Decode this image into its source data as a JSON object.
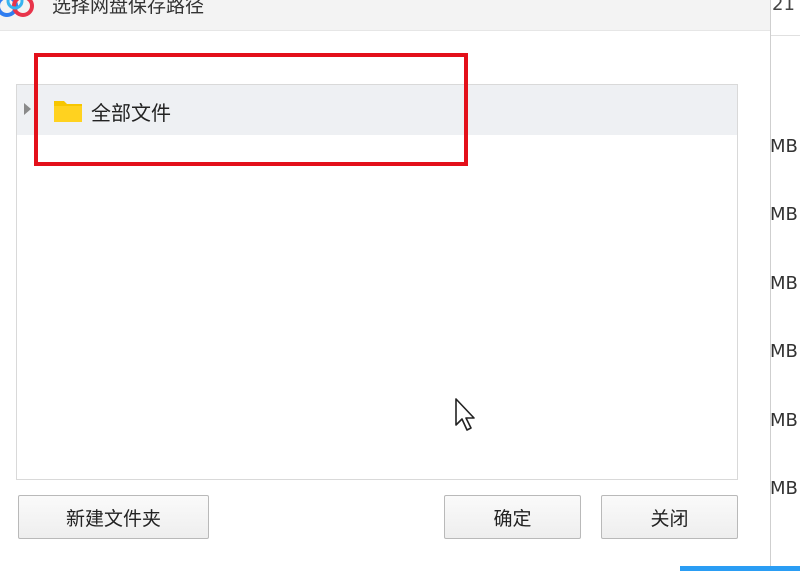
{
  "dialog": {
    "title": "选择网盘保存路径",
    "tree": {
      "root_label": "全部文件"
    },
    "buttons": {
      "new_folder": "新建文件夹",
      "confirm": "确定",
      "close": "关闭"
    }
  },
  "background": {
    "partial_number": "21",
    "size_fragments": [
      "MB",
      "MB",
      "MB",
      "MB",
      "MB",
      "MB"
    ]
  },
  "icons": {
    "app": "baidu-netdisk-cloud-icon",
    "folder": "folder-icon",
    "expander": "triangle-right-icon",
    "cursor": "mouse-pointer-icon"
  },
  "colors": {
    "highlight": "#e3101a",
    "folder": "#f7c600",
    "selection_row": "#eef0f3",
    "taskbar_accent": "#2a9df4"
  }
}
